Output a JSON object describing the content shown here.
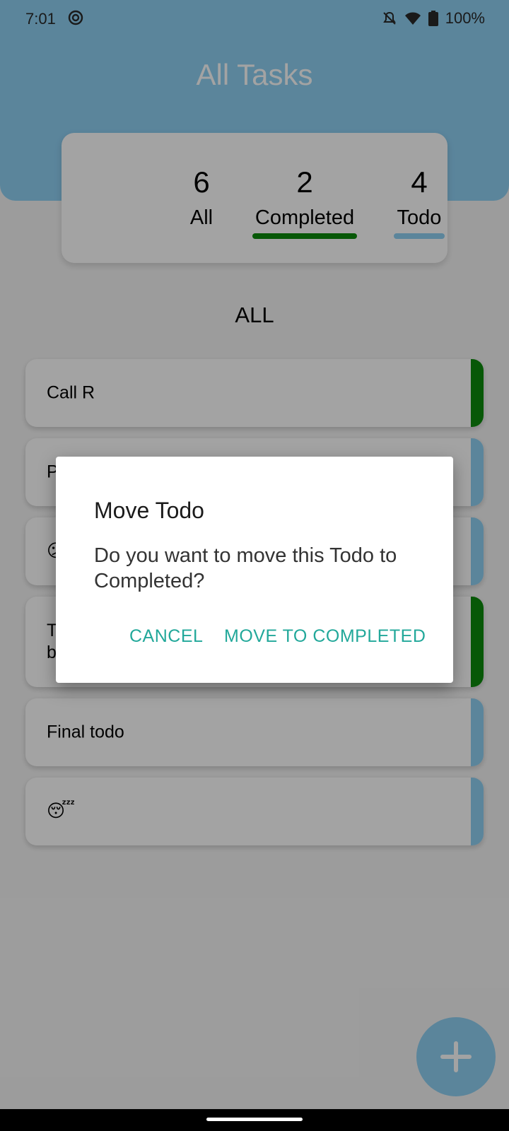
{
  "status": {
    "time": "7:01",
    "battery": "100%"
  },
  "header": {
    "title": "All Tasks"
  },
  "stats": {
    "all": {
      "count": "6",
      "label": "All"
    },
    "completed": {
      "count": "2",
      "label": "Completed"
    },
    "todo": {
      "count": "4",
      "label": "Todo"
    }
  },
  "section": {
    "title": "ALL"
  },
  "todos": [
    {
      "text": "Call R",
      "status": "completed"
    },
    {
      "text": "P",
      "status": "todo"
    },
    {
      "text": "😕",
      "status": "todo"
    },
    {
      "text": "T\nb",
      "status": "completed"
    },
    {
      "text": "Final todo",
      "status": "todo"
    },
    {
      "text": "😴",
      "status": "todo"
    }
  ],
  "dialog": {
    "title": "Move Todo",
    "message": "Do you want to move this Todo to Completed?",
    "cancel_label": "CANCEL",
    "confirm_label": "MOVE TO COMPLETED"
  },
  "colors": {
    "accent": "#8fd0f3",
    "completed": "#0b8a0b",
    "todo": "#8fd0f3",
    "dialog_button": "#22a89a"
  }
}
